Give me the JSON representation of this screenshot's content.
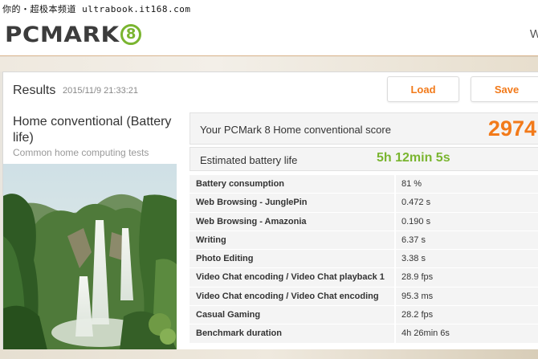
{
  "watermark": "你的・超极本频道 ultrabook.it168.com",
  "header": {
    "logo_text": "PCMARK",
    "logo_badge": "8",
    "right_text": "W"
  },
  "results": {
    "title": "Results",
    "date": "2015/11/9 21:33:21",
    "load_label": "Load",
    "save_label": "Save"
  },
  "test": {
    "title": "Home conventional (Battery life)",
    "subtitle": "Common home computing tests"
  },
  "score": {
    "label": "Your PCMark 8 Home conventional score",
    "value": "2974"
  },
  "battery": {
    "label": "Estimated battery life",
    "value": "5h 12min 5s"
  },
  "metrics": [
    {
      "name": "Battery consumption",
      "value": "81 %"
    },
    {
      "name": "Web Browsing - JunglePin",
      "value": "0.472 s"
    },
    {
      "name": "Web Browsing - Amazonia",
      "value": "0.190 s"
    },
    {
      "name": "Writing",
      "value": "6.37 s"
    },
    {
      "name": "Photo Editing",
      "value": "3.38 s"
    },
    {
      "name": "Video Chat encoding / Video Chat playback 1",
      "value": "28.9 fps"
    },
    {
      "name": "Video Chat encoding / Video Chat encoding",
      "value": "95.3 ms"
    },
    {
      "name": "Casual Gaming",
      "value": "28.2 fps"
    },
    {
      "name": "Benchmark duration",
      "value": "4h 26min 6s"
    }
  ],
  "colors": {
    "accent_orange": "#f27a1a",
    "accent_green": "#7ab530"
  }
}
